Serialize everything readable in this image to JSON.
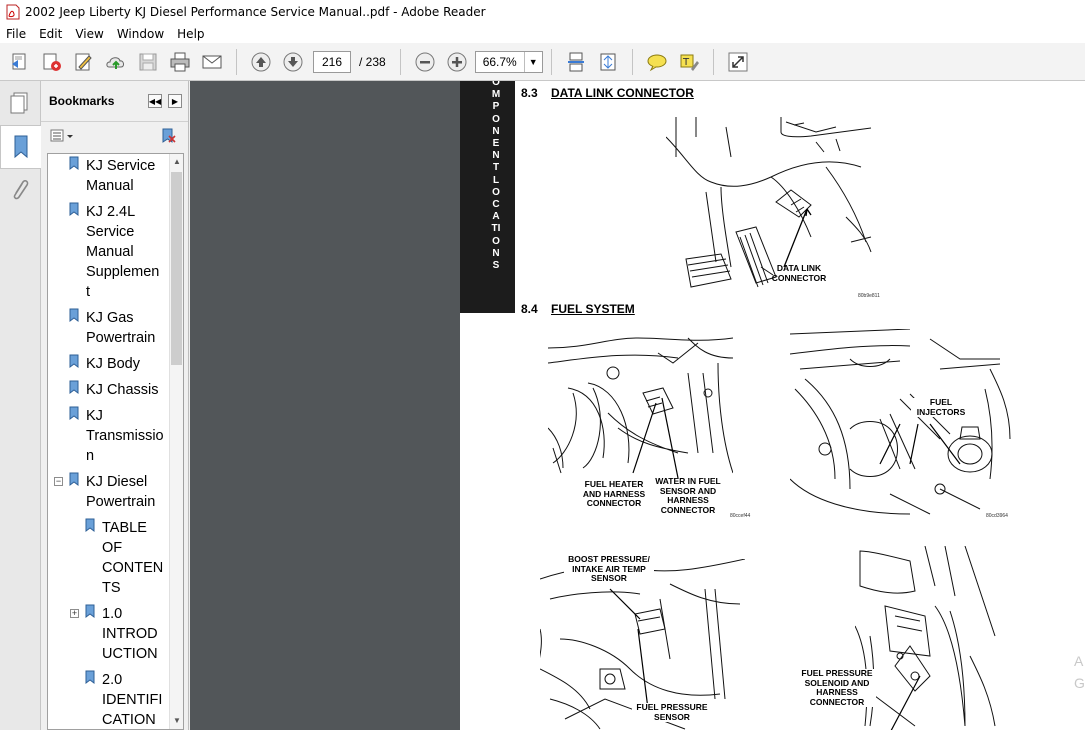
{
  "window": {
    "title": "2002 Jeep Liberty KJ Diesel Performance Service Manual..pdf - Adobe Reader"
  },
  "menu": [
    "File",
    "Edit",
    "View",
    "Window",
    "Help"
  ],
  "toolbar": {
    "current_page": "216",
    "total_pages": "/ 238",
    "zoom": "66.7%",
    "icons": [
      "create-pdf-icon",
      "acrobat-com-icon",
      "sign-icon",
      "upload-icon",
      "save-icon",
      "print-icon",
      "email-icon",
      "prev-page-icon",
      "next-page-icon",
      "zoom-out-icon",
      "zoom-in-icon",
      "scrolling-mode-icon",
      "fit-page-icon",
      "comment-icon",
      "highlight-icon",
      "fullscreen-icon"
    ]
  },
  "navpanel": {
    "title": "Bookmarks",
    "bookmarks": [
      {
        "label": "KJ Service Manual",
        "lines": [
          "KJ Service",
          "Manual"
        ]
      },
      {
        "label": "KJ 2.4L Service Manual Supplement",
        "lines": [
          "KJ 2.4L",
          "Service",
          "Manual",
          "Supplemen",
          "t"
        ]
      },
      {
        "label": "KJ Gas Powertrain",
        "lines": [
          "KJ Gas",
          "Powertrain"
        ]
      },
      {
        "label": "KJ Body",
        "lines": [
          "KJ Body"
        ]
      },
      {
        "label": "KJ Chassis",
        "lines": [
          "KJ Chassis"
        ]
      },
      {
        "label": "KJ Transmission",
        "lines": [
          "KJ",
          "Transmissio",
          "n"
        ]
      },
      {
        "label": "KJ Diesel Powertrain",
        "lines": [
          "KJ Diesel",
          "Powertrain"
        ]
      },
      {
        "label": "TABLE OF CONTENTS",
        "lines": [
          "TABLE",
          "OF",
          "CONTEN",
          "TS"
        ]
      },
      {
        "label": "1.0 INTRODUCTION",
        "lines": [
          "1.0",
          "INTROD",
          "UCTION"
        ]
      },
      {
        "label": "2.0 IDENTIFICATION",
        "lines": [
          "2.0",
          "IDENTIFI",
          "CATION"
        ]
      }
    ]
  },
  "document": {
    "side_tab": "COMPONENT LOCATIONS",
    "side_tab_visible": "OMPONENT LOCATIONS",
    "section_83": {
      "num": "8.3",
      "title": "DATA LINK CONNECTOR"
    },
    "section_84": {
      "num": "8.4",
      "title": "FUEL SYSTEM"
    },
    "fig1": {
      "label": "DATA LINK\nCONNECTOR",
      "code": "80b9e811"
    },
    "fig2": {
      "label_left": "FUEL HEATER\nAND HARNESS\nCONNECTOR",
      "label_right": "WATER IN FUEL\nSENSOR AND\nHARNESS\nCONNECTOR",
      "code": "80ccef44"
    },
    "fig3": {
      "label": "FUEL\nINJECTORS",
      "code": "80cd3964"
    },
    "fig4": {
      "label_top": "BOOST PRESSURE/\nINTAKE AIR TEMP\nSENSOR",
      "label_bottom": "FUEL PRESSURE\nSENSOR"
    },
    "fig5": {
      "label": "FUEL PRESSURE\nSOLENOID AND\nHARNESS\nCONNECTOR"
    },
    "edge_text": [
      "A",
      "G"
    ]
  }
}
